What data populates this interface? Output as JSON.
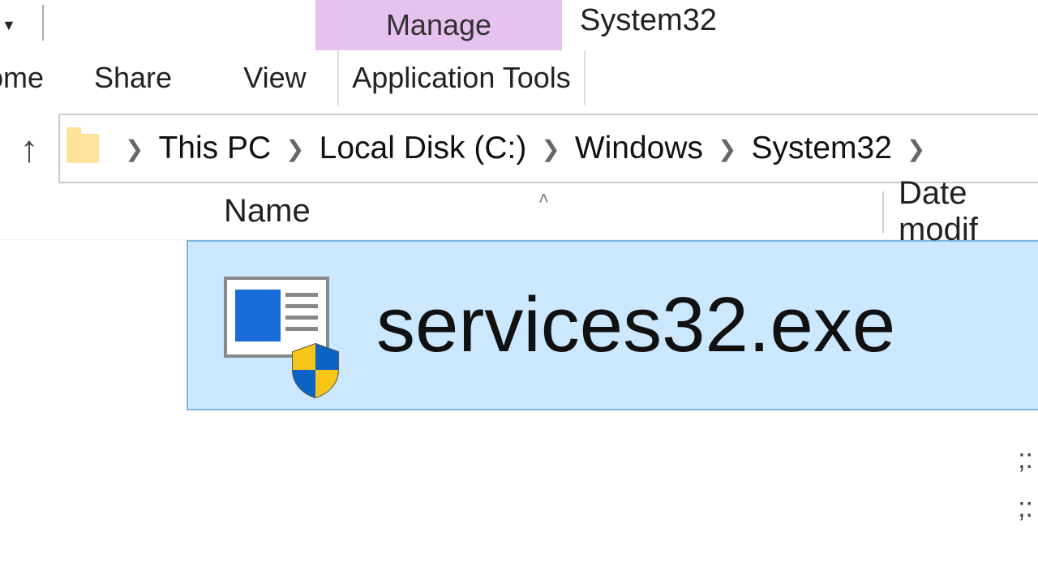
{
  "title": {
    "manage_tab": "Manage",
    "window": "System32"
  },
  "ribbon": {
    "home": "ome",
    "share": "Share",
    "view": "View",
    "application_tools": "Application Tools"
  },
  "breadcrumb": {
    "items": [
      "This PC",
      "Local Disk (C:)",
      "Windows",
      "System32"
    ]
  },
  "columns": {
    "name": "Name",
    "date_modified": "Date modif"
  },
  "files": [
    {
      "name": "services32.exe"
    }
  ],
  "right_fragments": [
    ";:",
    "",
    ";:"
  ]
}
